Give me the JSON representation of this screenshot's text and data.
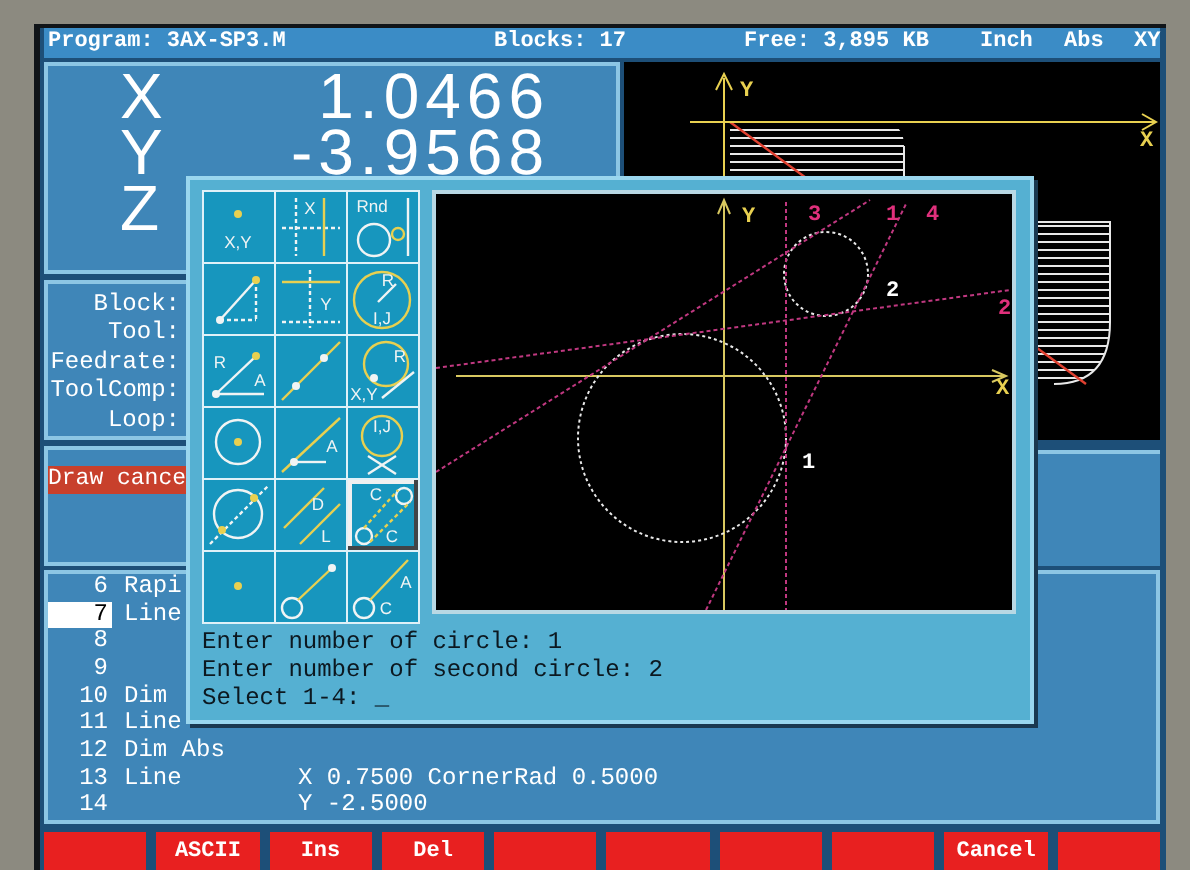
{
  "header": {
    "program": "Program: 3AX-SP3.M",
    "blocks": "Blocks: 17",
    "free": "Free: 3,895 KB",
    "units": "Inch",
    "mode": "Abs",
    "plane": "XY"
  },
  "position": [
    {
      "axis": "X",
      "value": "1.0466"
    },
    {
      "axis": "Y",
      "value": "-3.9568"
    },
    {
      "axis": "Z"
    }
  ],
  "info_labels": [
    "Block:",
    "Tool:",
    "Feedrate:",
    "ToolComp:",
    "Loop:"
  ],
  "message": "Draw cance",
  "graphic": {
    "axis_labels": [
      "Y",
      "X"
    ]
  },
  "dialog": {
    "palette": [
      {
        "kind": "point-xy",
        "labels": [
          "X,Y"
        ],
        "selected": false
      },
      {
        "kind": "vertical-x",
        "labels": [
          "X"
        ],
        "selected": false
      },
      {
        "kind": "corner-round",
        "labels": [
          "Rnd"
        ],
        "selected": false
      },
      {
        "kind": "two-points",
        "selected": false
      },
      {
        "kind": "horizontal-y",
        "labels": [
          "Y"
        ],
        "selected": false
      },
      {
        "kind": "circle-radius-center",
        "labels": [
          "R",
          "I,J"
        ],
        "selected": false
      },
      {
        "kind": "radius-angle",
        "labels": [
          "R",
          "A"
        ],
        "selected": false
      },
      {
        "kind": "line-two-points",
        "selected": false
      },
      {
        "kind": "circle-point-radius",
        "labels": [
          "R",
          "X,Y"
        ],
        "selected": false
      },
      {
        "kind": "circle-center",
        "selected": false
      },
      {
        "kind": "line-point-angle",
        "labels": [
          "A"
        ],
        "selected": false
      },
      {
        "kind": "circle-tangent",
        "labels": [
          "I,J"
        ],
        "selected": false
      },
      {
        "kind": "circle-two-points",
        "selected": false
      },
      {
        "kind": "parallel-offset",
        "labels": [
          "D",
          "L"
        ],
        "selected": false
      },
      {
        "kind": "tangent-circles",
        "labels": [
          "C",
          "C"
        ],
        "selected": true
      },
      {
        "kind": "point",
        "selected": false
      },
      {
        "kind": "circle-line-point",
        "selected": false
      },
      {
        "kind": "circle-line-angle",
        "labels": [
          "A",
          "C"
        ],
        "selected": false
      }
    ],
    "canvas_labels": [
      {
        "kind": "axis",
        "text": "Y"
      },
      {
        "kind": "axis",
        "text": "X"
      },
      {
        "kind": "line",
        "text": "3"
      },
      {
        "kind": "line",
        "text": "1"
      },
      {
        "kind": "line",
        "text": "4"
      },
      {
        "kind": "line",
        "text": "2"
      },
      {
        "kind": "circle",
        "text": "2"
      },
      {
        "kind": "circle",
        "text": "1"
      }
    ],
    "prompts": [
      "Enter number of circle: 1",
      "Enter number of second circle: 2",
      "Select 1-4: _"
    ]
  },
  "listing": [
    {
      "number": "6",
      "command": "Rapi",
      "selected": false
    },
    {
      "number": "7",
      "command": "Line",
      "selected": true
    },
    {
      "number": "8",
      "selected": false
    },
    {
      "number": "9",
      "selected": false
    },
    {
      "number": "10",
      "command": "Dim",
      "selected": false
    },
    {
      "number": "11",
      "command": "Line",
      "selected": false
    },
    {
      "number": "12",
      "command": "Dim Abs",
      "selected": false
    },
    {
      "number": "13",
      "command": "Line",
      "params": "X 0.7500 CornerRad 0.5000",
      "selected": false
    },
    {
      "number": "14",
      "params": "Y -2.5000",
      "selected": false
    }
  ],
  "softkeys": [
    {
      "kind": "blank"
    },
    {
      "kind": "key",
      "label": "ASCII"
    },
    {
      "kind": "key",
      "label": "Ins"
    },
    {
      "kind": "key",
      "label": "Del"
    },
    {
      "kind": "blank"
    },
    {
      "kind": "blank"
    },
    {
      "kind": "blank"
    },
    {
      "kind": "blank"
    },
    {
      "kind": "key",
      "label": "Cancel"
    },
    {
      "kind": "blank"
    }
  ]
}
